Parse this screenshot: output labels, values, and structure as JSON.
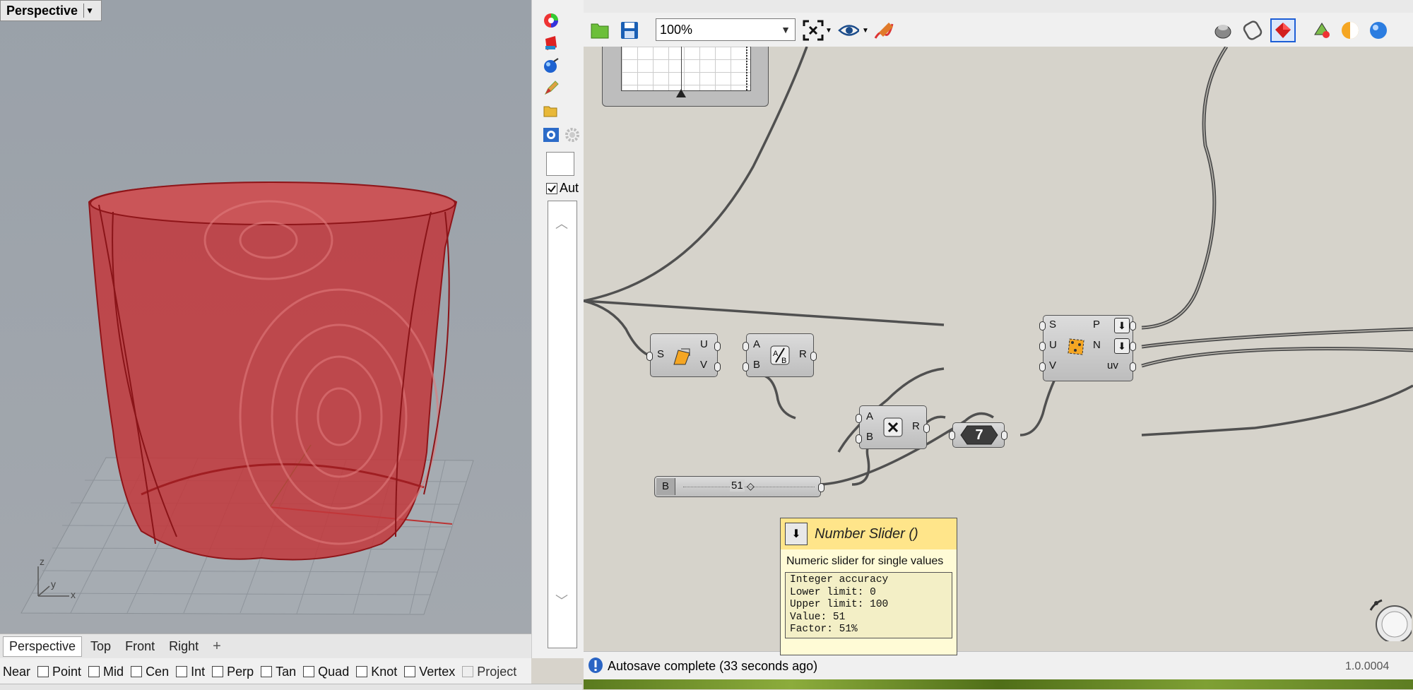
{
  "rhino": {
    "viewport_title": "Perspective",
    "viewport_tabs": [
      "Perspective",
      "Top",
      "Front",
      "Right"
    ],
    "add_tab": "+",
    "axis_labels": {
      "z": "z",
      "y": "y",
      "x": "x"
    },
    "osnaps": [
      {
        "label": "Near",
        "checkbox": false
      },
      {
        "label": "Point",
        "checkbox": true
      },
      {
        "label": "Mid",
        "checkbox": true
      },
      {
        "label": "Cen",
        "checkbox": true
      },
      {
        "label": "Int",
        "checkbox": true
      },
      {
        "label": "Perp",
        "checkbox": true
      },
      {
        "label": "Tan",
        "checkbox": true
      },
      {
        "label": "Quad",
        "checkbox": true
      },
      {
        "label": "Knot",
        "checkbox": true
      },
      {
        "label": "Vertex",
        "checkbox": true
      },
      {
        "label": "Project",
        "checkbox": true,
        "disabled": true
      }
    ]
  },
  "gh_left": {
    "autofix_label": "Aut"
  },
  "grasshopper": {
    "zoom": "100%",
    "status": "Autosave complete (33 seconds ago)",
    "version": "1.0.0004",
    "components": {
      "deconstruct_domain": {
        "input": "S",
        "outputs": [
          "U",
          "V"
        ]
      },
      "division": {
        "inputs": [
          "A",
          "B"
        ],
        "output": "R"
      },
      "multiplication": {
        "inputs": [
          "A",
          "B"
        ],
        "output": "R"
      },
      "panel_value": "7",
      "evaluate_surface": {
        "inputs": [
          "S",
          "U",
          "V"
        ],
        "outputs": [
          "P",
          "N",
          "uv"
        ]
      },
      "slider": {
        "label": "B",
        "value": "51"
      }
    },
    "tooltip": {
      "title": "Number Slider ()",
      "description": "Numeric slider for single values",
      "details": [
        "Integer accuracy",
        "Lower limit: 0",
        "Upper limit: 100",
        "Value: 51",
        "Factor: 51%"
      ]
    }
  },
  "colors": {
    "mesh_red": "#b9242a",
    "canvas": "#d6d3cb",
    "tooltip_header": "#ffe58a",
    "selected_button": "#1d5ed6"
  }
}
